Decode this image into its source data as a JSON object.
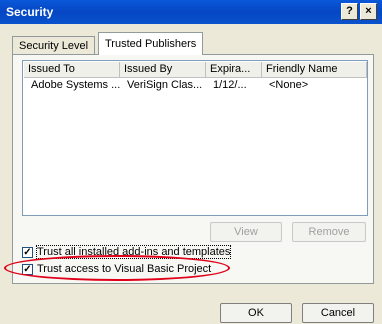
{
  "window": {
    "title": "Security",
    "help_glyph": "?",
    "close_glyph": "×"
  },
  "tabs": [
    {
      "label": "Security Level"
    },
    {
      "label": "Trusted Publishers",
      "active": true
    }
  ],
  "table": {
    "headers": [
      "Issued To",
      "Issued By",
      "Expira...",
      "Friendly Name"
    ],
    "rows": [
      [
        "Adobe Systems ...",
        "VeriSign Clas...",
        "1/12/...",
        "<None>"
      ]
    ]
  },
  "buttons": {
    "view": "View",
    "remove": "Remove",
    "ok": "OK",
    "cancel": "Cancel"
  },
  "checkboxes": [
    {
      "label": "Trust all installed add-ins and templates",
      "checked": true
    },
    {
      "label": "Trust access to Visual Basic Project",
      "checked": true
    }
  ],
  "check_glyph": "✓",
  "colors": {
    "title_bar": "#0546c4",
    "dialog_bg": "#ece9d8",
    "highlight_oval": "#e0001a"
  }
}
